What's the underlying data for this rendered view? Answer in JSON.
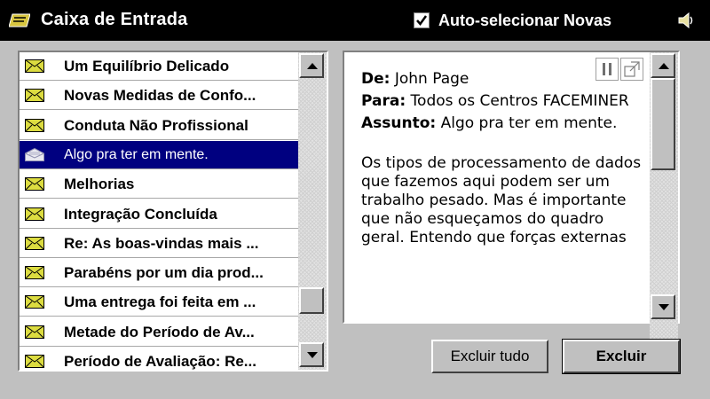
{
  "window": {
    "title": "Caixa de Entrada"
  },
  "header": {
    "auto_select_label": "Auto-selecionar Novas",
    "auto_select_checked": true
  },
  "inbox": {
    "items": [
      {
        "subject": "Um Equilíbrio Delicado",
        "read": false,
        "selected": false
      },
      {
        "subject": "Novas Medidas de Confo...",
        "read": false,
        "selected": false
      },
      {
        "subject": "Conduta Não Profissional",
        "read": false,
        "selected": false
      },
      {
        "subject": "Algo pra ter em mente.",
        "read": true,
        "selected": true
      },
      {
        "subject": "Melhorias",
        "read": false,
        "selected": false
      },
      {
        "subject": "Integração Concluída",
        "read": false,
        "selected": false
      },
      {
        "subject": "Re: As boas-vindas mais ...",
        "read": false,
        "selected": false
      },
      {
        "subject": "Parabéns por um dia prod...",
        "read": false,
        "selected": false
      },
      {
        "subject": "Uma entrega foi feita em ...",
        "read": false,
        "selected": false
      },
      {
        "subject": "Metade do Período de Av...",
        "read": false,
        "selected": false
      },
      {
        "subject": "Período de Avaliação: Re...",
        "read": false,
        "selected": false
      }
    ]
  },
  "message": {
    "from_label": "De:",
    "from": "John Page",
    "to_label": "Para:",
    "to": "Todos os Centros FACEMINER",
    "subject_label": "Assunto:",
    "subject": "Algo pra ter em mente.",
    "body": "Os tipos de processamento de dados que fazemos aqui podem ser um trabalho pesado. Mas é importante que não esqueçamos do quadro geral. Entendo que forças externas"
  },
  "buttons": {
    "delete_all": "Excluir tudo",
    "delete": "Excluir"
  },
  "colors": {
    "selection": "#000080",
    "titlebar": "#000000",
    "envelope": "#dcdc40"
  }
}
